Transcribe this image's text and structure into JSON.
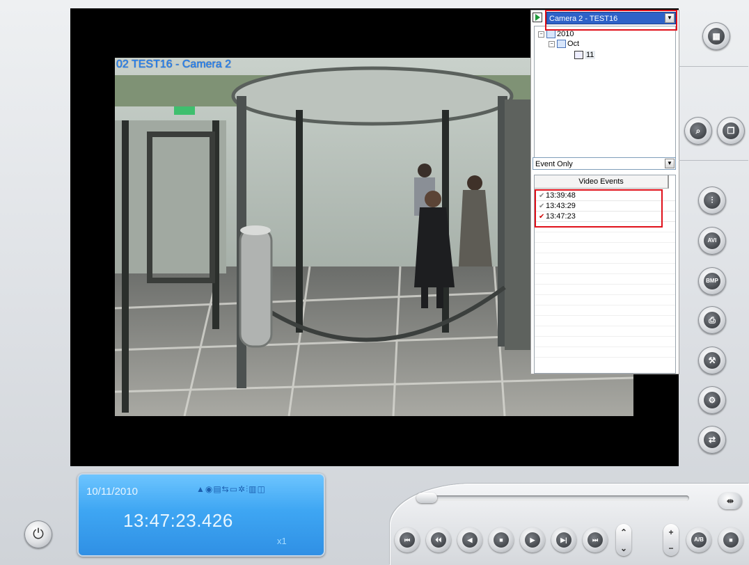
{
  "video": {
    "overlay_label": "02 TEST16 - Camera 2"
  },
  "panel": {
    "camera_select": "Camera 2 - TEST16",
    "tree": {
      "year": "2010",
      "month": "Oct",
      "day": "11"
    },
    "filter_select": "Event Only",
    "events_header": "Video Events",
    "events": [
      {
        "time": "13:39:48",
        "checked": true,
        "active": false
      },
      {
        "time": "13:43:29",
        "checked": true,
        "active": false
      },
      {
        "time": "13:47:23",
        "checked": true,
        "active": true
      }
    ]
  },
  "lcd": {
    "date": "10/11/2010",
    "time": "13:47:23.426",
    "speed": "x1"
  },
  "playback": {
    "position_fraction": 0.0
  },
  "icons": {
    "right_toolbar": [
      "layout-icon",
      "search-playback-icon",
      "copy-icon",
      "adjust-icon",
      "save-avi-icon",
      "save-bmp-icon",
      "print-icon",
      "tools-icon",
      "settings-icon",
      "export-icon"
    ],
    "transport": [
      "skip-start-icon",
      "previous-icon",
      "step-back-icon",
      "stop-icon",
      "play-icon",
      "step-forward-icon",
      "skip-end-icon"
    ]
  },
  "colors": {
    "overlay_text": "#1d86ff",
    "lcd_background": "#3ea6f3",
    "highlight": "#e0101a"
  }
}
